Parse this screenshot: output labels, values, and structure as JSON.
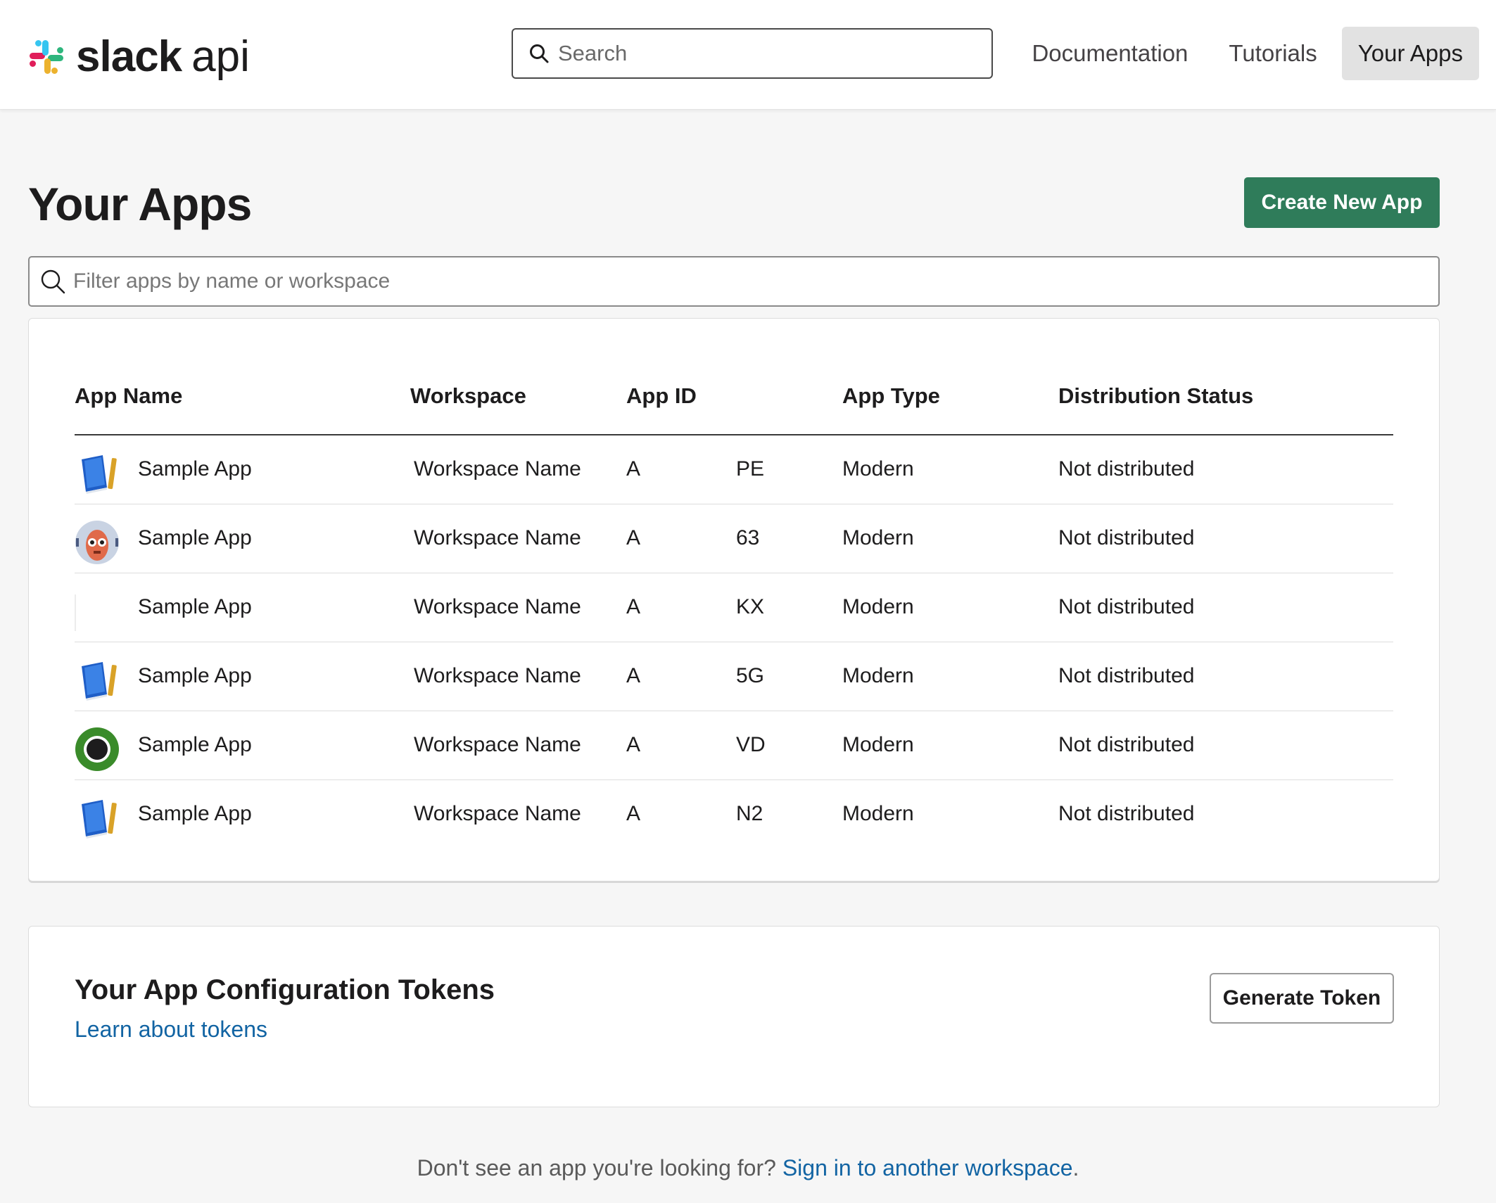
{
  "header": {
    "logo_word": "slack",
    "logo_suffix": "api",
    "search_placeholder": "Search",
    "nav": [
      {
        "label": "Documentation",
        "active": false
      },
      {
        "label": "Tutorials",
        "active": false
      },
      {
        "label": "Your Apps",
        "active": true
      }
    ]
  },
  "page": {
    "title": "Your Apps",
    "create_button": "Create New App",
    "filter_placeholder": "Filter apps by name or workspace"
  },
  "apps_table": {
    "columns": [
      "App Name",
      "Workspace",
      "App ID",
      "App Type",
      "Distribution Status"
    ],
    "rows": [
      {
        "icon": "book-icon",
        "name": "Sample App",
        "workspace": "Workspace Name",
        "id_prefix": "A",
        "id_suffix": "PE",
        "type": "Modern",
        "distribution": "Not distributed"
      },
      {
        "icon": "robot-avatar-icon",
        "name": "Sample App",
        "workspace": "Workspace Name",
        "id_prefix": "A",
        "id_suffix": "63",
        "type": "Modern",
        "distribution": "Not distributed"
      },
      {
        "icon": "blank-icon",
        "name": "Sample App",
        "workspace": "Workspace Name",
        "id_prefix": "A",
        "id_suffix": "KX",
        "type": "Modern",
        "distribution": "Not distributed"
      },
      {
        "icon": "book-icon",
        "name": "Sample App",
        "workspace": "Workspace Name",
        "id_prefix": "A",
        "id_suffix": "5G",
        "type": "Modern",
        "distribution": "Not distributed"
      },
      {
        "icon": "green-circle-icon",
        "name": "Sample App",
        "workspace": "Workspace Name",
        "id_prefix": "A",
        "id_suffix": "VD",
        "type": "Modern",
        "distribution": "Not distributed"
      },
      {
        "icon": "book-icon",
        "name": "Sample App",
        "workspace": "Workspace Name",
        "id_prefix": "A",
        "id_suffix": "N2",
        "type": "Modern",
        "distribution": "Not distributed"
      }
    ]
  },
  "tokens": {
    "title": "Your App Configuration Tokens",
    "learn_link": "Learn about tokens",
    "generate_button": "Generate Token"
  },
  "footer": {
    "text": "Don't see an app you're looking for?",
    "link": "Sign in to another workspace",
    "period": "."
  },
  "colors": {
    "primary_button": "#2f7c5a",
    "link": "#1264a3",
    "nav_active_bg": "#e2e2e2",
    "page_bg": "#f6f6f6"
  }
}
